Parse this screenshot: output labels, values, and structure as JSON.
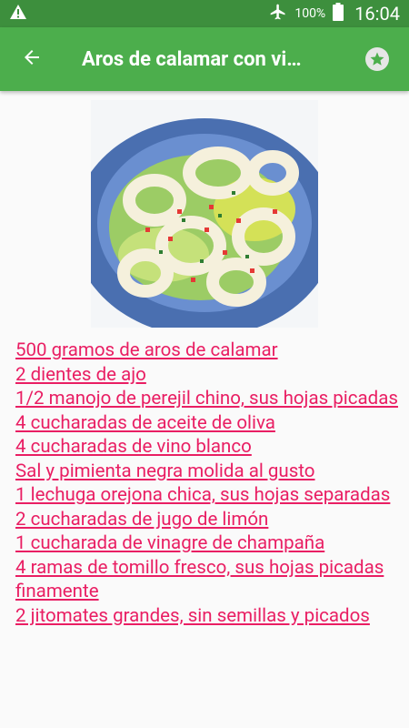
{
  "status_bar": {
    "battery": "100%",
    "time": "16:04",
    "icons": [
      "warning-icon",
      "airplane-mode-icon",
      "battery-icon"
    ]
  },
  "app_bar": {
    "title": "Aros de calamar con vi…",
    "back_icon": "arrow-back-icon",
    "favorite_icon": "star-icon"
  },
  "recipe": {
    "image_alt": "recipe-photo",
    "ingredients": [
      "500 gramos de aros de calamar",
      "2 dientes de ajo",
      "1/2 manojo de perejil chino, sus hojas picadas",
      "4 cucharadas de aceite de oliva",
      "4 cucharadas de vino blanco",
      "Sal y pimienta negra molida al gusto",
      "1 lechuga orejona chica, sus hojas separadas",
      "2 cucharadas de jugo de limón",
      "1 cucharada de vinagre de champaña",
      "4 ramas de tomillo fresco, sus hojas picadas finamente",
      "2 jitomates grandes, sin semillas y picados"
    ]
  },
  "colors": {
    "status_bar": "#3d8f3d",
    "app_bar": "#4cae4c",
    "link_text": "#e91e63",
    "background": "#fafafa"
  }
}
